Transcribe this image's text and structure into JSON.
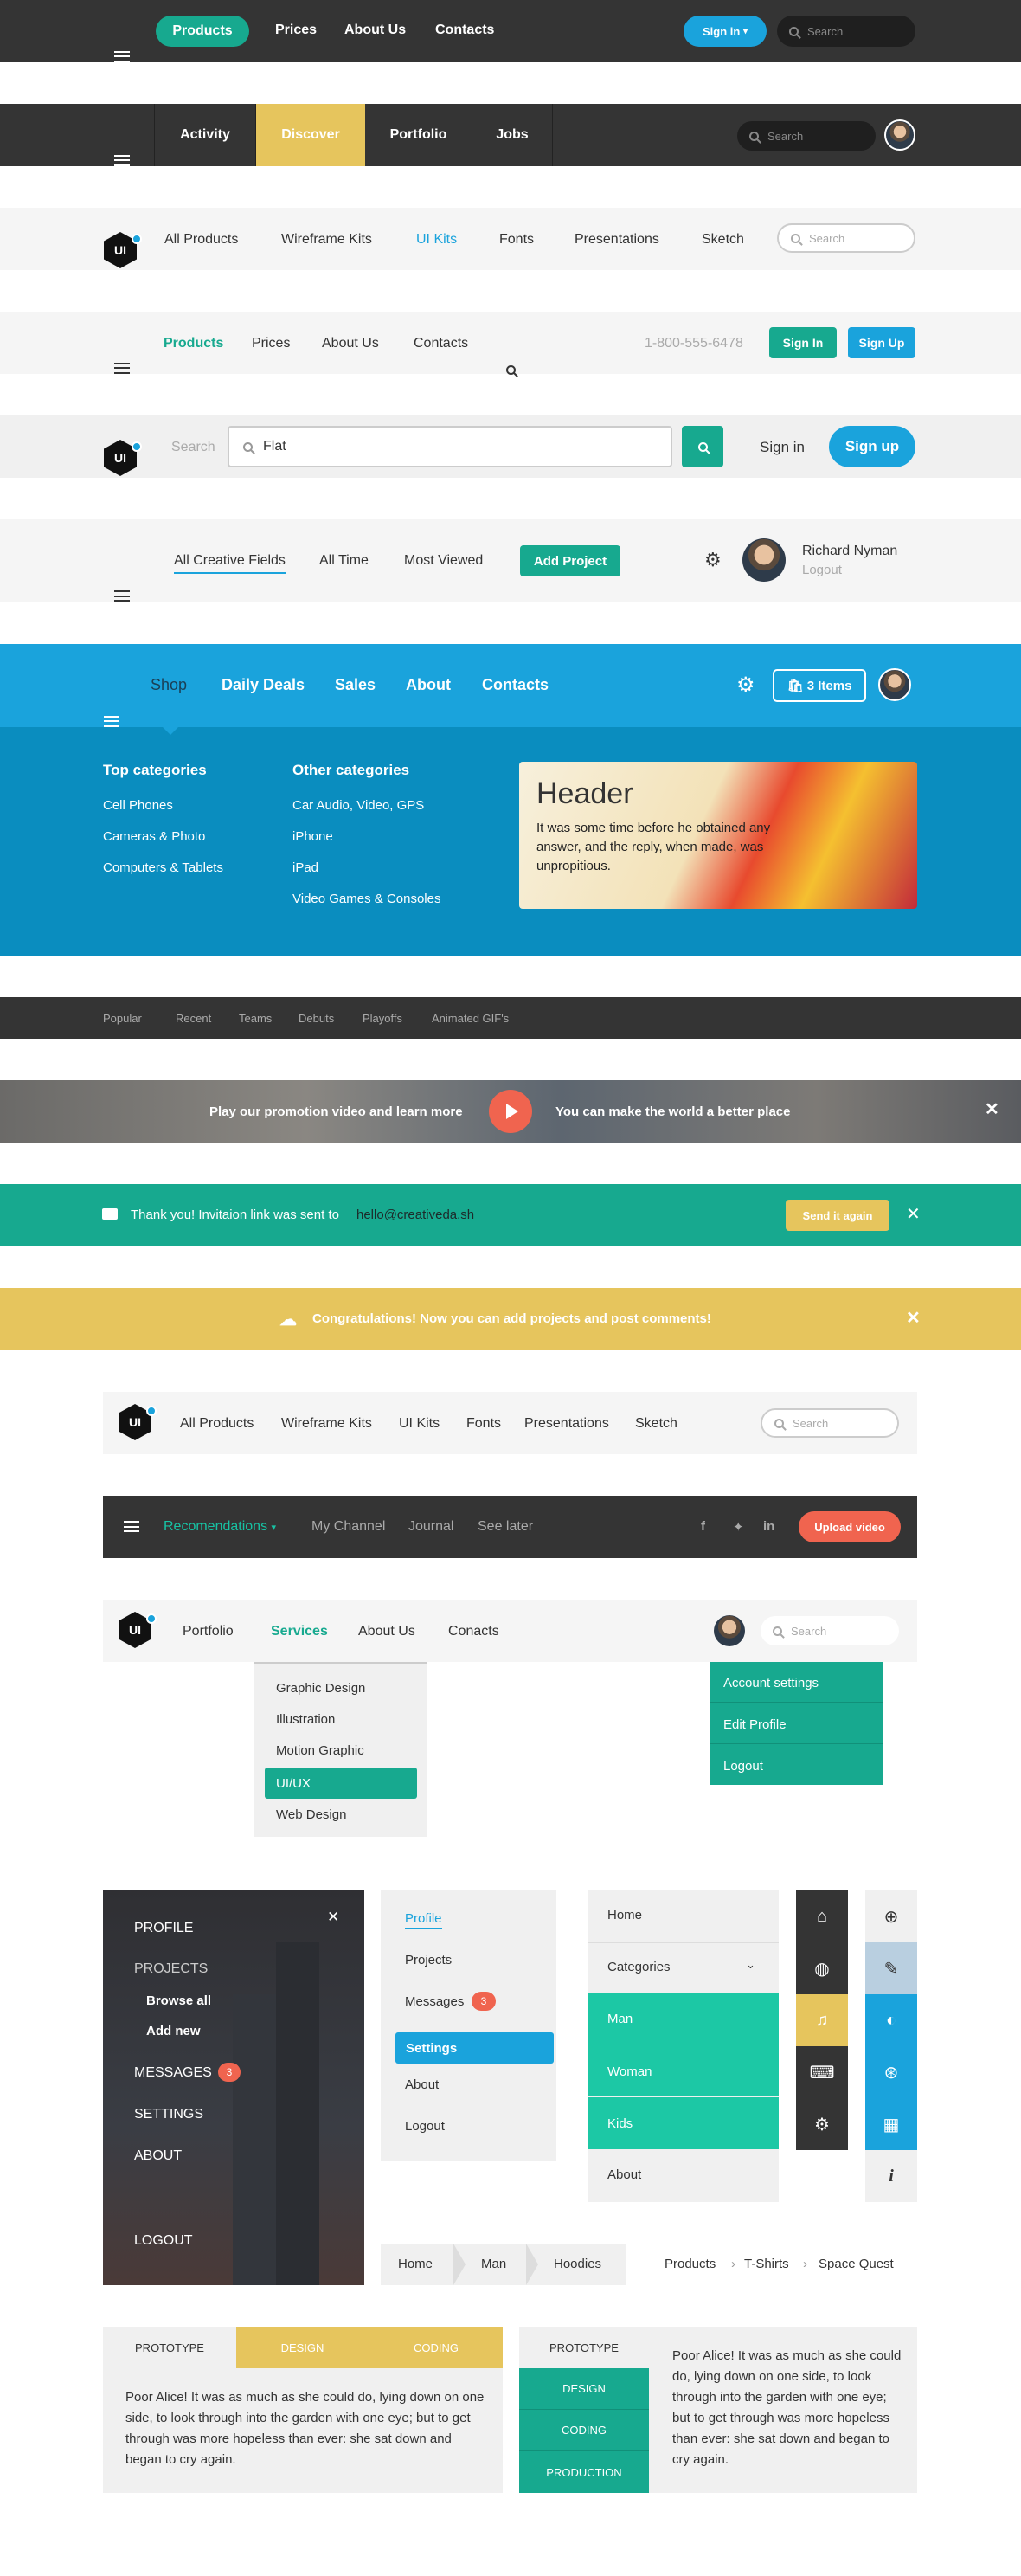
{
  "nav1": {
    "menu_icon": "hamburger-icon",
    "items": [
      "Products",
      "Prices",
      "About Us",
      "Contacts"
    ],
    "signin": "Sign in",
    "search": "Search"
  },
  "nav2": {
    "tabs": [
      "Activity",
      "Discover",
      "Portfolio",
      "Jobs"
    ],
    "search": "Search"
  },
  "nav3": {
    "logo": "UI",
    "items": [
      "All Products",
      "Wireframe Kits",
      "UI Kits",
      "Fonts",
      "Presentations",
      "Sketch"
    ],
    "search": "Search"
  },
  "nav4": {
    "items": [
      "Products",
      "Prices",
      "About Us",
      "Contacts"
    ],
    "phone": "1-800-555-6478",
    "signin": "Sign In",
    "signup": "Sign Up"
  },
  "nav5": {
    "logo": "UI",
    "search_label": "Search",
    "search_value": "Flat",
    "signin": "Sign in",
    "signup": "Sign up"
  },
  "nav6": {
    "items": [
      "All Creative Fields",
      "All Time",
      "Most Viewed"
    ],
    "add": "Add Project",
    "user": "Richard Nyman",
    "logout": "Logout"
  },
  "nav7": {
    "items": [
      "Shop",
      "Daily Deals",
      "Sales",
      "About",
      "Contacts"
    ],
    "cart": "3 Items",
    "top_title": "Top categories",
    "top": [
      "Cell Phones",
      "Cameras & Photo",
      "Computers & Tablets"
    ],
    "other_title": "Other categories",
    "other": [
      "Car Audio, Video, GPS",
      "iPhone",
      "iPad",
      "Video Games & Consoles"
    ],
    "card_title": "Header",
    "card_text": "It was some time before he obtained any answer, and the reply, when made, was unpropitious."
  },
  "nav8": {
    "items": [
      "Popular",
      "Recent",
      "Teams",
      "Debuts",
      "Playoffs",
      "Animated GIF's"
    ]
  },
  "promo": {
    "left": "Play our promotion video and learn more",
    "right": "You can make the world a better place"
  },
  "invite": {
    "text": "Thank you! Invitaion link was sent to",
    "email": "hello@creativeda.sh",
    "button": "Send it again"
  },
  "congrats": {
    "text": "Congratulations! Now you can add projects and post comments!"
  },
  "nav9": {
    "logo": "UI",
    "items": [
      "All Products",
      "Wireframe Kits",
      "UI Kits",
      "Fonts",
      "Presentations",
      "Sketch"
    ],
    "search": "Search"
  },
  "nav10": {
    "items": [
      "Recomendations",
      "My Channel",
      "Journal",
      "See later"
    ],
    "upload": "Upload video"
  },
  "nav11": {
    "logo": "UI",
    "items": [
      "Portfolio",
      "Services",
      "About Us",
      "Conacts"
    ],
    "search": "Search",
    "services": [
      "Graphic Design",
      "Illustration",
      "Motion Graphic",
      "UI/UX",
      "Web Design"
    ],
    "account": [
      "Account settings",
      "Edit Profile",
      "Logout"
    ]
  },
  "side1": {
    "items": [
      "PROFILE",
      "PROJECTS",
      "Browse all",
      "Add new",
      "MESSAGES",
      "SETTINGS",
      "ABOUT",
      "LOGOUT"
    ],
    "badge": "3"
  },
  "side2": {
    "items": [
      "Profile",
      "Projects",
      "Messages",
      "Settings",
      "About",
      "Logout"
    ],
    "badge": "3"
  },
  "side3": {
    "items": [
      "Home",
      "Categories",
      "Man",
      "Woman",
      "Kids",
      "About"
    ]
  },
  "icons1": [
    "home-icon",
    "globe-icon",
    "music-icon",
    "gamepad-icon",
    "gear-icon"
  ],
  "icons2": [
    "zoom-icon",
    "wrench-icon",
    "contrast-icon",
    "target-icon",
    "layout-icon",
    "info-icon"
  ],
  "crumb1": [
    "Home",
    "Man",
    "Hoodies"
  ],
  "crumb2": [
    "Products",
    "T-Shirts",
    "Space Quest"
  ],
  "tabs1": {
    "tabs": [
      "PROTOTYPE",
      "DESIGN",
      "CODING"
    ],
    "text": "Poor Alice! It was as much as she could do, lying down on one side, to look through into the garden with one eye; but to get through was more hopeless than ever: she sat down and began to cry again."
  },
  "tabs2": {
    "tabs": [
      "PROTOTYPE",
      "DESIGN",
      "CODING",
      "PRODUCTION"
    ],
    "text": "Poor Alice! It was as much as she could do, lying down on one side, to look through into the garden with one eye; but to get through was more hopeless than ever: she sat down and began to cry again."
  },
  "colors": {
    "dark": "#333333",
    "teal": "#17a98f",
    "yellow": "#e6c55d",
    "blue": "#1aa3dc",
    "red": "#f0644f"
  }
}
